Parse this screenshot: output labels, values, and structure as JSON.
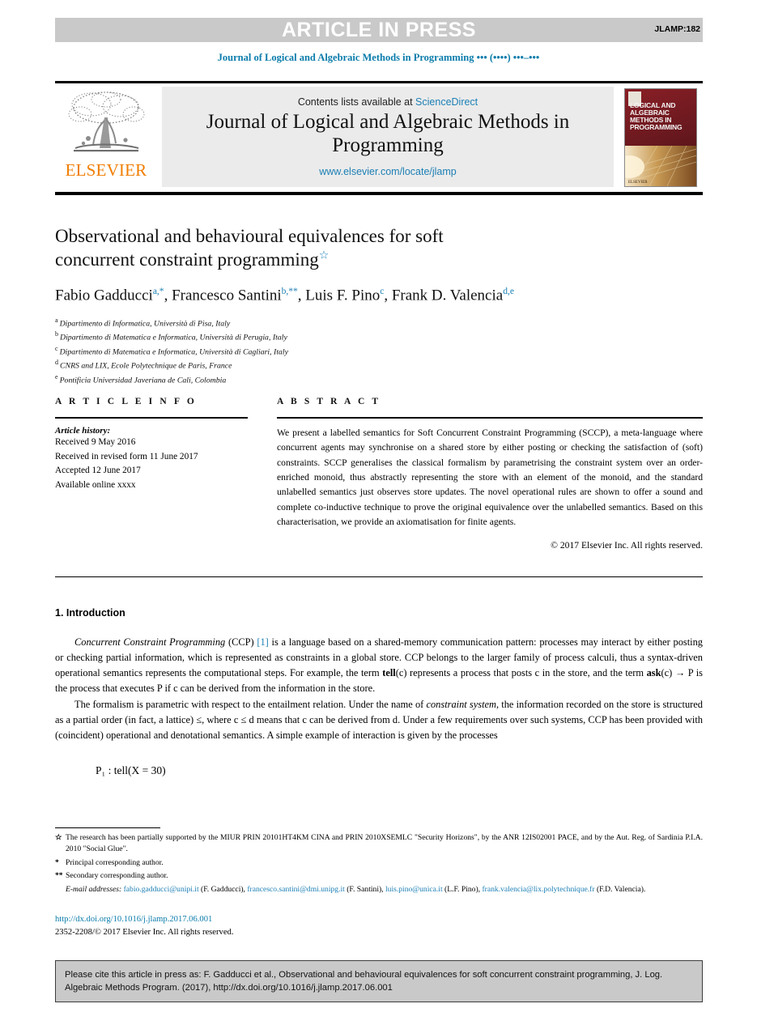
{
  "banner": {
    "press_label": "ARTICLE IN PRESS",
    "article_code": "JLAMP:182",
    "running_head": "Journal of Logical and Algebraic Methods in Programming ••• (••••) •••–•••"
  },
  "masthead": {
    "contents_prefix": "Contents lists available at ",
    "sciencedirect": "ScienceDirect",
    "journal_name": "Journal of Logical and Algebraic Methods in Programming",
    "journal_url": "www.elsevier.com/locate/jlamp",
    "publisher": "ELSEVIER",
    "cover_title": "LOGICAL AND ALGEBRAIC METHODS IN PROGRAMMING",
    "cover_publisher": "ELSEVIER"
  },
  "article": {
    "title": "Observational and behavioural equivalences for soft concurrent constraint programming",
    "title_line1": "Observational and behavioural equivalences for soft",
    "title_line2": "concurrent constraint programming",
    "title_footnote_mark": "☆",
    "authors": [
      {
        "name": "Fabio Gadducci",
        "marks": "a,*",
        "sep": ", "
      },
      {
        "name": "Francesco Santini",
        "marks": "b,**",
        "sep": ", "
      },
      {
        "name": "Luis F. Pino",
        "marks": "c",
        "sep": ", "
      },
      {
        "name": "Frank D. Valencia",
        "marks": "d,e",
        "sep": ""
      }
    ],
    "affiliations": [
      {
        "label": "a",
        "text": "Dipartimento di Informatica, Università di Pisa, Italy"
      },
      {
        "label": "b",
        "text": "Dipartimento di Matematica e Informatica, Università di Perugia, Italy"
      },
      {
        "label": "c",
        "text": "Dipartimento di Matematica e Informatica, Università di Cagliari, Italy"
      },
      {
        "label": "d",
        "text": "CNRS and LIX, Ecole Polytechnique de Paris, France"
      },
      {
        "label": "e",
        "text": "Pontificia Universidad Javeriana de Cali, Colombia"
      }
    ]
  },
  "article_info": {
    "heading": "A R T I C L E   I N F O",
    "history_label": "Article history:",
    "history": [
      "Received 9 May 2016",
      "Received in revised form 11 June 2017",
      "Accepted 12 June 2017",
      "Available online xxxx"
    ]
  },
  "abstract": {
    "heading": "A B S T R A C T",
    "text": "We present a labelled semantics for Soft Concurrent Constraint Programming (SCCP), a meta-language where concurrent agents may synchronise on a shared store by either posting or checking the satisfaction of (soft) constraints. SCCP generalises the classical formalism by parametrising the constraint system over an order-enriched monoid, thus abstractly representing the store with an element of the monoid, and the standard unlabelled semantics just observes store updates. The novel operational rules are shown to offer a sound and complete co-inductive technique to prove the original equivalence over the unlabelled semantics. Based on this characterisation, we provide an axiomatisation for finite agents.",
    "copyright": "© 2017 Elsevier Inc. All rights reserved."
  },
  "introduction": {
    "section_number_title": "1. Introduction",
    "para1_a": "Concurrent Constraint Programming",
    "para1_b": " (CCP) ",
    "para1_cite": "[1]",
    "para1_c": " is a language based on a shared-memory communication pattern: processes may interact by either posting or checking partial information, which is represented as constraints in a global store. CCP belongs to the larger family of process calculi, thus a syntax-driven operational semantics represents the computational steps. For example, the term ",
    "para1_tell": "tell",
    "para1_d": "(c) represents a process that posts c in the store, and the term ",
    "para1_ask": "ask",
    "para1_e": "(c) → P is the process that executes P if c can be derived from the information in the store.",
    "para2_a": "The formalism is parametric with respect to the entailment relation. Under the name of ",
    "para2_cs": "constraint system",
    "para2_b": ", the information recorded on the store is structured as a partial order (in fact, a lattice) ≤, where c ≤ d means that c can be derived from d. Under a few requirements over such systems, CCP has been provided with (coincident) operational and denotational semantics. A simple example of interaction is given by the processes",
    "formula": "P₁ : tell(X = 30)"
  },
  "footnotes": [
    {
      "mark": "☆",
      "text": "The research has been partially supported by the MIUR PRIN 20101HT4KM CINA and PRIN 2010XSEMLC \"Security Horizons\", by the ANR 12IS02001 PACE, and by the Aut. Reg. of Sardinia P.I.A. 2010 \"Social Glue\"."
    },
    {
      "mark": "*",
      "text": "Principal corresponding author."
    },
    {
      "mark": "**",
      "text": "Secondary corresponding author."
    }
  ],
  "emails": {
    "label": "E-mail addresses:",
    "entries": [
      {
        "address": "fabio.gadducci@unipi.it",
        "owner": " (F. Gadducci), "
      },
      {
        "address": "francesco.santini@dmi.unipg.it",
        "owner": " (F. Santini), "
      },
      {
        "address": "luis.pino@unica.it",
        "owner": " (L.F. Pino), "
      },
      {
        "address": "frank.valencia@lix.polytechnique.fr",
        "owner": " (F.D. Valencia)."
      }
    ]
  },
  "publication": {
    "doi_url": "http://dx.doi.org/10.1016/j.jlamp.2017.06.001",
    "issn_line": "2352-2208/© 2017 Elsevier Inc. All rights reserved."
  },
  "cite_box": {
    "text": "Please cite this article in press as: F. Gadducci et al., Observational and behavioural equivalences for soft concurrent constraint programming, J. Log. Algebraic Methods Program. (2017), http://dx.doi.org/10.1016/j.jlamp.2017.06.001"
  },
  "colors": {
    "link": "#1c7fb5",
    "banner_bg": "#c9c9c9",
    "elsevier_orange": "#f07d00"
  }
}
